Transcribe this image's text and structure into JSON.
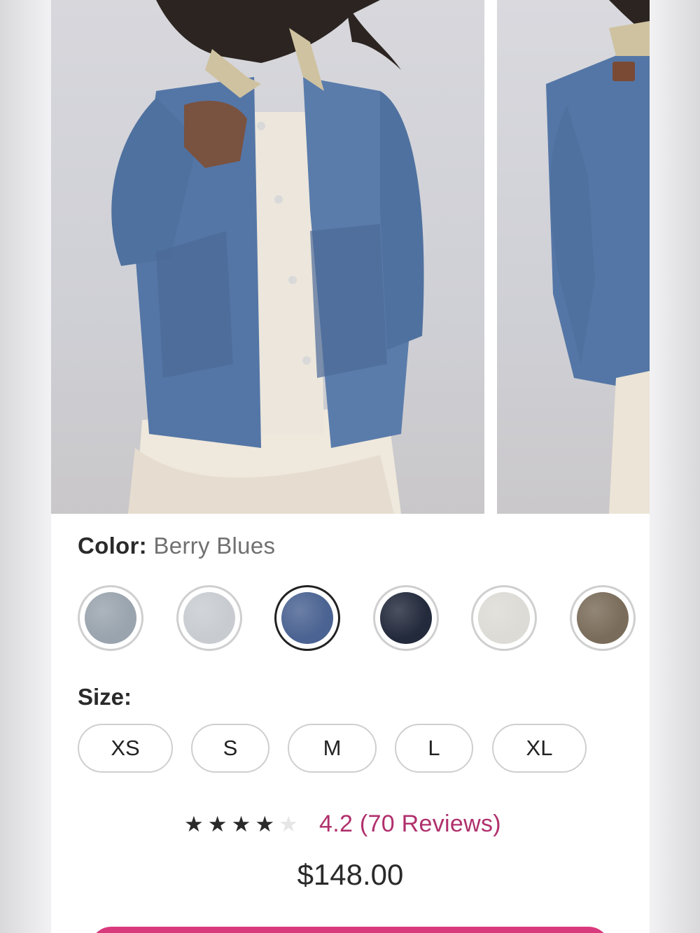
{
  "product": {
    "color_label": "Color:",
    "color_value": "Berry Blues",
    "swatches": [
      {
        "name": "light-wash-denim",
        "color": "#9aa4ae",
        "selected": false
      },
      {
        "name": "bleached-denim",
        "color": "#c8ccd0",
        "selected": false
      },
      {
        "name": "berry-blues",
        "color": "#4b6392",
        "selected": true
      },
      {
        "name": "dark-indigo",
        "color": "#232a3c",
        "selected": false
      },
      {
        "name": "ivory",
        "color": "#dcdbd5",
        "selected": false
      },
      {
        "name": "olive-taupe",
        "color": "#7a6c5a",
        "selected": false
      }
    ],
    "size_label": "Size:",
    "sizes": [
      "XS",
      "S",
      "M",
      "L",
      "XL"
    ],
    "rating": {
      "value": 4.2,
      "stars_filled": 4,
      "stars_total": 5,
      "text": "4.2 (70 Reviews)"
    },
    "price": "$148.00"
  },
  "colors": {
    "accent": "#d93a7e",
    "review_link": "#b0306c",
    "selected_border": "#222222",
    "unselected_border": "#cfcfcf"
  },
  "icons": {
    "star": "star-icon"
  }
}
